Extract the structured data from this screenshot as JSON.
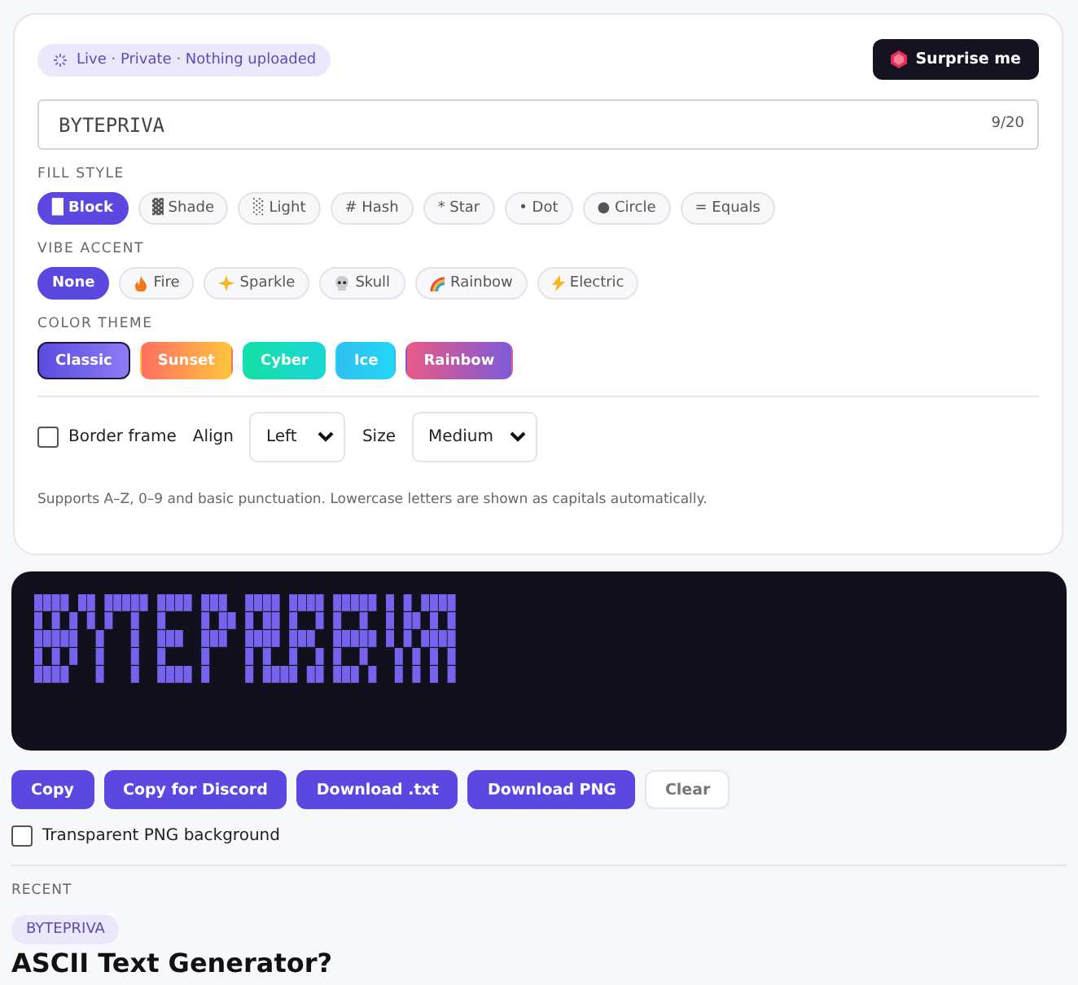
{
  "status_badge": {
    "text": "Live · Private · Nothing uploaded"
  },
  "surprise_button": {
    "label": "Surprise me"
  },
  "text_input": {
    "value": "BYTEPRIVA",
    "counter": "9/20"
  },
  "fill_style": {
    "label": "FILL STYLE",
    "options": [
      {
        "label": "█ Block",
        "selected": true
      },
      {
        "label": "▓ Shade",
        "selected": false
      },
      {
        "label": "░ Light",
        "selected": false
      },
      {
        "label": "# Hash",
        "selected": false
      },
      {
        "label": "* Star",
        "selected": false
      },
      {
        "label": "• Dot",
        "selected": false
      },
      {
        "label": "● Circle",
        "selected": false
      },
      {
        "label": "= Equals",
        "selected": false
      }
    ]
  },
  "vibe_accent": {
    "label": "VIBE ACCENT",
    "options": [
      {
        "label": "None",
        "kind": "none",
        "selected": true
      },
      {
        "label": "Fire",
        "kind": "fire",
        "selected": false
      },
      {
        "label": "Sparkle",
        "kind": "sparkle",
        "selected": false
      },
      {
        "label": "Skull",
        "kind": "skull",
        "selected": false
      },
      {
        "label": "Rainbow",
        "kind": "rainbow",
        "selected": false
      },
      {
        "label": "Electric",
        "kind": "electric",
        "selected": false
      }
    ]
  },
  "color_theme": {
    "label": "COLOR THEME",
    "options": [
      {
        "label": "Classic",
        "kind": "classic",
        "selected": true
      },
      {
        "label": "Sunset",
        "kind": "sunset",
        "selected": false
      },
      {
        "label": "Cyber",
        "kind": "cyber",
        "selected": false
      },
      {
        "label": "Ice",
        "kind": "ice",
        "selected": false
      },
      {
        "label": "Rainbow",
        "kind": "rainbow",
        "selected": false
      }
    ]
  },
  "options_row": {
    "border_frame": {
      "label": "Border frame",
      "checked": false
    },
    "align": {
      "label": "Align",
      "value": "Left"
    },
    "size": {
      "label": "Size",
      "value": "Medium"
    }
  },
  "helper_text": "Supports A–Z, 0–9 and basic punctuation. Lowercase letters are shown as capitals automatically.",
  "actions": [
    {
      "label": "Copy",
      "kind": "primary"
    },
    {
      "label": "Copy for Discord",
      "kind": "primary"
    },
    {
      "label": "Download .txt",
      "kind": "primary"
    },
    {
      "label": "Download PNG",
      "kind": "primary"
    },
    {
      "label": "Clear",
      "kind": "secondary"
    }
  ],
  "transparent_png": {
    "label": "Transparent PNG background",
    "checked": false
  },
  "recent": {
    "label": "RECENT",
    "items": [
      "BYTEPRIVA"
    ]
  },
  "heading": "ASCII Text Generator?"
}
